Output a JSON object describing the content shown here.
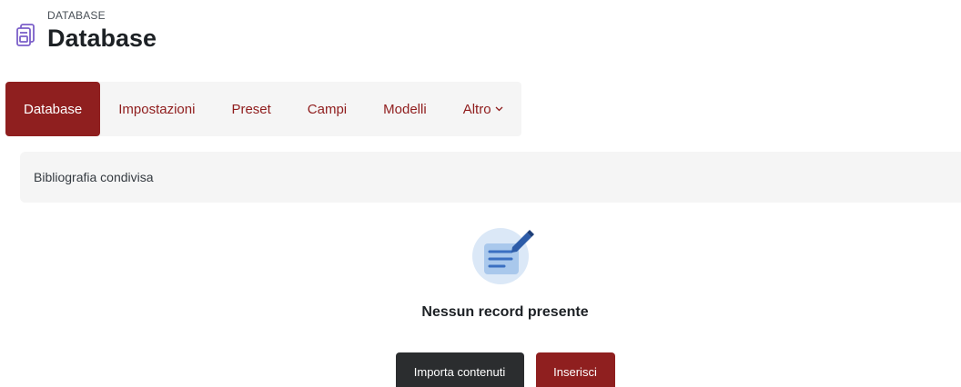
{
  "header": {
    "eyebrow": "DATABASE",
    "title": "Database",
    "icon": "database-icon"
  },
  "tabs": [
    {
      "label": "Database",
      "active": true
    },
    {
      "label": "Impostazioni",
      "active": false
    },
    {
      "label": "Preset",
      "active": false
    },
    {
      "label": "Campi",
      "active": false
    },
    {
      "label": "Modelli",
      "active": false
    },
    {
      "label": "Altro",
      "active": false,
      "dropdown": true
    }
  ],
  "namebar": {
    "text": "Bibliografia condivisa"
  },
  "empty_state": {
    "icon": "edit-document-icon",
    "title": "Nessun record presente"
  },
  "actions": {
    "import_label": "Importa contenuti",
    "insert_label": "Inserisci"
  },
  "colors": {
    "brand": "#8f1f1f",
    "dark_button": "#2b2d2f",
    "icon_purple": "#7b5fc9",
    "icon_blue": "#3a6fc1"
  }
}
